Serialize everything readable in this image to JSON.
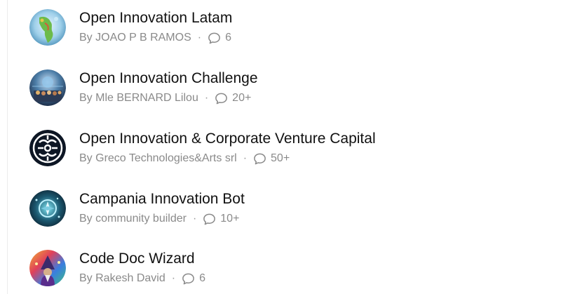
{
  "items": [
    {
      "title": "Open Innovation Latam",
      "by_prefix": "By",
      "author": "JOAO P B RAMOS",
      "separator": "·",
      "count": "6",
      "avatar_icon": "globe-latam-icon"
    },
    {
      "title": "Open Innovation Challenge",
      "by_prefix": "By",
      "author": "Mle BERNARD Lilou",
      "separator": "·",
      "count": "20+",
      "avatar_icon": "crowd-tech-icon"
    },
    {
      "title": "Open Innovation & Corporate Venture Capital",
      "by_prefix": "By",
      "author": "Greco Technologies&Arts srl",
      "separator": "·",
      "count": "50+",
      "avatar_icon": "circuit-emblem-icon"
    },
    {
      "title": "Campania Innovation Bot",
      "by_prefix": "By",
      "author": "community builder",
      "separator": "·",
      "count": "10+",
      "avatar_icon": "compass-tech-icon"
    },
    {
      "title": "Code Doc Wizard",
      "by_prefix": "By",
      "author": "Rakesh David",
      "separator": "·",
      "count": "6",
      "avatar_icon": "wizard-icon"
    }
  ],
  "colors": {
    "title": "#111111",
    "meta": "#8a8a8a",
    "divider": "#ececec"
  }
}
